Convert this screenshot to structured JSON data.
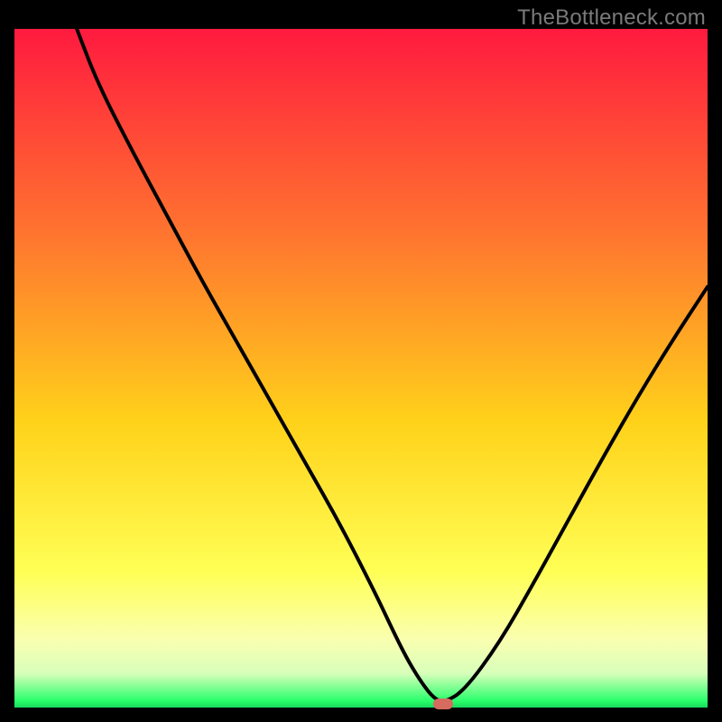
{
  "watermark": "TheBottleneck.com",
  "colors": {
    "top": "#ff1a3f",
    "mid_upper": "#ff6b33",
    "mid": "#ffd21a",
    "lower_yellow": "#ffff66",
    "pale": "#f7ffb3",
    "green": "#2aff6b",
    "curve": "#000000",
    "marker": "#d66b5f",
    "background": "#000000"
  },
  "chart_data": {
    "type": "line",
    "title": "",
    "xlabel": "",
    "ylabel": "",
    "xlim": [
      0,
      100
    ],
    "ylim": [
      0,
      100
    ],
    "legend": false,
    "grid": false,
    "series": [
      {
        "name": "bottleneck-curve",
        "x": [
          9,
          12,
          17,
          22,
          27,
          32,
          37,
          42,
          47,
          52,
          55,
          57,
          59,
          60.5,
          62,
          65,
          70,
          75,
          80,
          85,
          90,
          95,
          100
        ],
        "y": [
          100,
          92,
          82,
          72.5,
          63,
          54,
          45,
          36,
          27,
          17,
          10.5,
          6.5,
          3.3,
          1.4,
          0.7,
          2.6,
          9.6,
          18.5,
          27.8,
          37,
          45.9,
          54.2,
          62
        ]
      }
    ],
    "annotations": [
      {
        "name": "min-marker",
        "x": 61.8,
        "y": 0.5
      }
    ],
    "background_gradient_stops": [
      {
        "pct": 0,
        "color": "#ff1a3f"
      },
      {
        "pct": 32,
        "color": "#ff7a2e"
      },
      {
        "pct": 58,
        "color": "#ffd21a"
      },
      {
        "pct": 80,
        "color": "#ffff55"
      },
      {
        "pct": 90,
        "color": "#faffb0"
      },
      {
        "pct": 95,
        "color": "#d7ffba"
      },
      {
        "pct": 99,
        "color": "#2aff6b"
      },
      {
        "pct": 100,
        "color": "#17d95c"
      }
    ]
  }
}
